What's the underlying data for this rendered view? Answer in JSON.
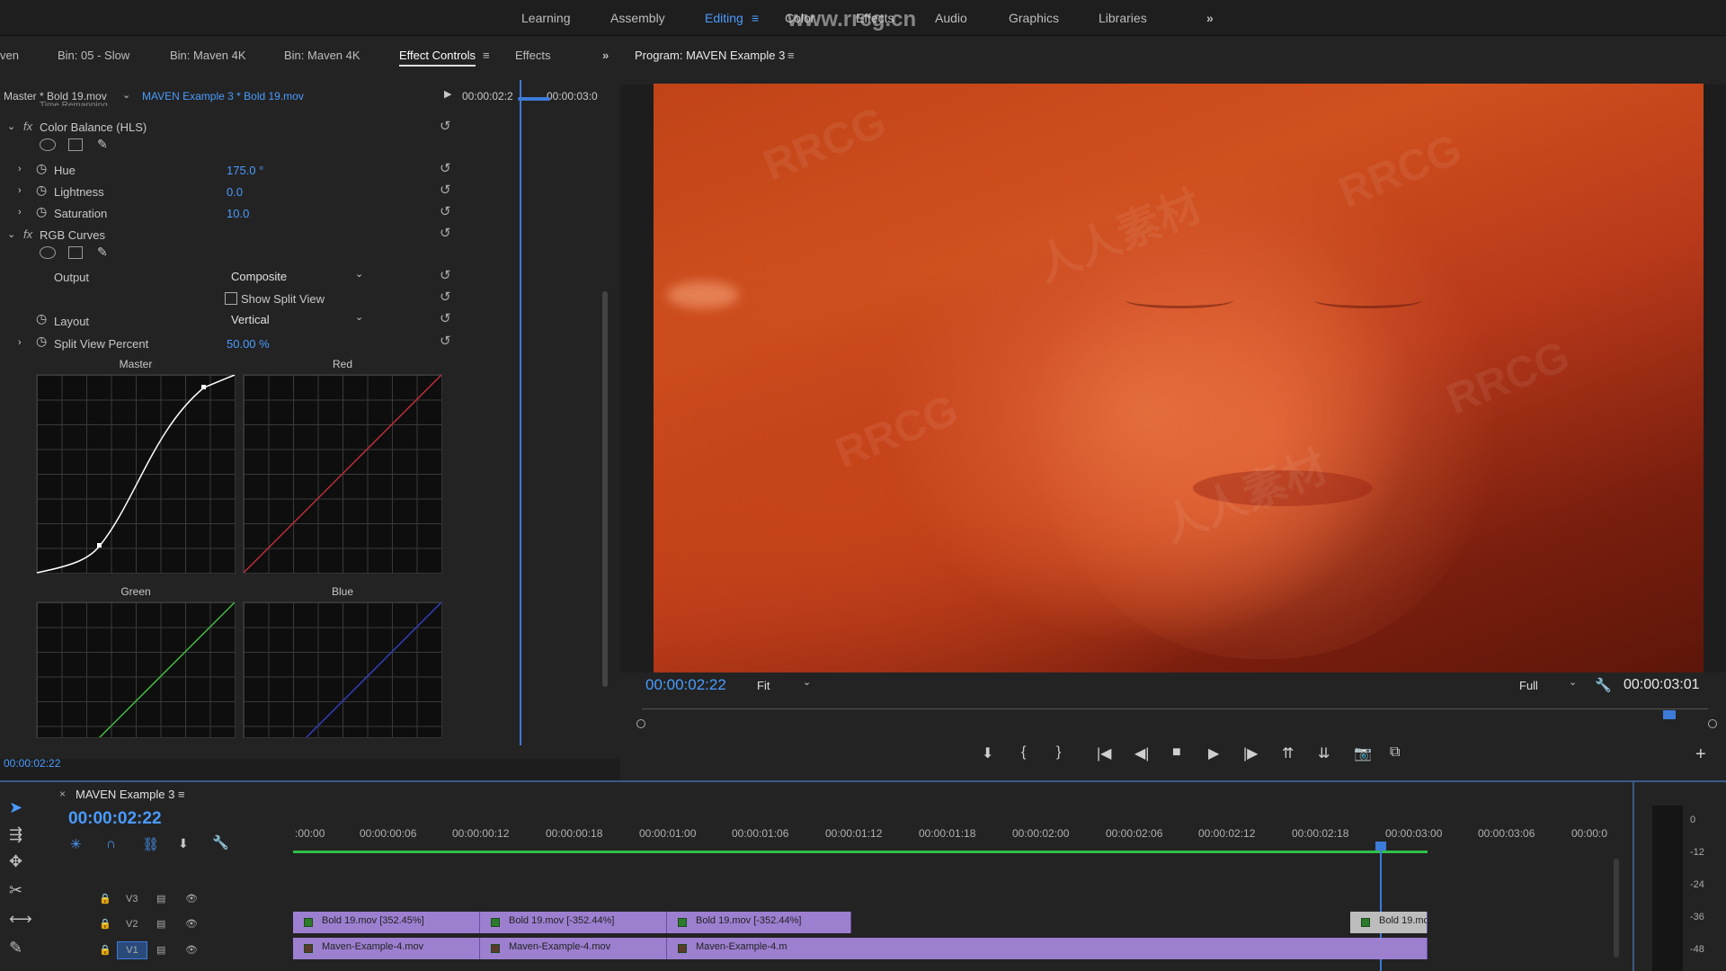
{
  "workspaces": {
    "learning": "Learning",
    "assembly": "Assembly",
    "editing": "Editing",
    "color": "Color",
    "effects": "Effects",
    "audio": "Audio",
    "graphics": "Graphics",
    "libraries": "Libraries"
  },
  "watermark_url": "www.rrcg.cn",
  "left_tabs": {
    "cut": "ven",
    "bin1": "Bin: 05 - Slow",
    "bin2": "Bin: Maven 4K",
    "bin3": "Bin: Maven 4K",
    "effect_controls": "Effect Controls",
    "effects": "Effects"
  },
  "ec": {
    "master": "Master * Bold 19.mov",
    "clip": "MAVEN Example 3 * Bold 19.mov",
    "tc_in": "00:00:02:2",
    "tc_out": "00:00:03:0",
    "clipped_row": "Time Remapping",
    "color_balance": {
      "name": "Color Balance (HLS)",
      "hue_label": "Hue",
      "hue": "175.0 °",
      "lightness_label": "Lightness",
      "lightness": "0.0",
      "saturation_label": "Saturation",
      "saturation": "10.0"
    },
    "rgb_curves": {
      "name": "RGB Curves",
      "output_label": "Output",
      "output": "Composite",
      "split_view": "Show Split View",
      "layout_label": "Layout",
      "layout": "Vertical",
      "split_percent_label": "Split View Percent",
      "split_percent": "50.00 %",
      "curves": {
        "master": "Master",
        "red": "Red",
        "green": "Green",
        "blue": "Blue"
      }
    },
    "timecode": "00:00:02:22"
  },
  "program": {
    "title": "Program: MAVEN Example 3",
    "timecode": "00:00:02:22",
    "fit": "Fit",
    "quality": "Full",
    "duration": "00:00:03:01",
    "watermark_text": "RRCG",
    "watermark_cn": "人人素材"
  },
  "timeline": {
    "name": "MAVEN Example 3",
    "timecode": "00:00:02:22",
    "ruler": [
      ":00:00",
      "00:00:00:06",
      "00:00:00:12",
      "00:00:00:18",
      "00:00:01:00",
      "00:00:01:06",
      "00:00:01:12",
      "00:00:01:18",
      "00:00:02:00",
      "00:00:02:06",
      "00:00:02:12",
      "00:00:02:18",
      "00:00:03:00",
      "00:00:03:06",
      "00:00:0"
    ],
    "tracks": {
      "v3": "V3",
      "v2": "V2",
      "v1": "V1"
    },
    "v2_clips": [
      "Bold 19.mov [352.45%]",
      "Bold 19.mov [-352.44%]",
      "Bold 19.mov [-352.44%]",
      "Bold 19.mo"
    ],
    "v1_clips": [
      "Maven-Example-4.mov",
      "Maven-Example-4.mov",
      "Maven-Example-4.m"
    ],
    "meter": [
      "0",
      "-12",
      "-24",
      "-36",
      "-48"
    ]
  },
  "colors": {
    "accent": "#4a9bff",
    "clip": "#9d7fd0"
  }
}
